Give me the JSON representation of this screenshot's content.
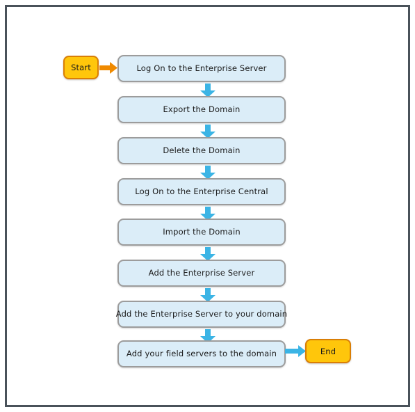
{
  "diagram": {
    "title": "Enterprise Server domain migration flowchart",
    "colors": {
      "frame_border": "#4a525a",
      "canvas_background": "#ffffff",
      "process_fill": "#dbedf8",
      "process_border": "#9c9c9c",
      "terminator_fill": "#ffc60b",
      "terminator_border": "#d97e06",
      "arrow_blue": "#3bb4e5",
      "arrow_orange": "#f08a00",
      "text": "#1a1a1a"
    },
    "start_node": {
      "label": "Start",
      "shape": "rounded-terminator"
    },
    "end_node": {
      "label": "End",
      "shape": "rounded-terminator"
    },
    "steps": [
      {
        "index": 1,
        "label": "Log On to the Enterprise Server"
      },
      {
        "index": 2,
        "label": "Export the Domain"
      },
      {
        "index": 3,
        "label": "Delete the Domain"
      },
      {
        "index": 4,
        "label": "Log On to the Enterprise Central"
      },
      {
        "index": 5,
        "label": "Import the Domain"
      },
      {
        "index": 6,
        "label": "Add the Enterprise Server"
      },
      {
        "index": 7,
        "label": "Add the Enterprise Server to your domain"
      },
      {
        "index": 8,
        "label": "Add your field servers to the domain"
      }
    ],
    "connectors": {
      "start_to_first": {
        "direction": "right",
        "color": "#f08a00"
      },
      "between_steps": {
        "direction": "down",
        "color": "#3bb4e5",
        "count": 7
      },
      "last_to_end": {
        "direction": "right",
        "color": "#3bb4e5"
      }
    }
  }
}
